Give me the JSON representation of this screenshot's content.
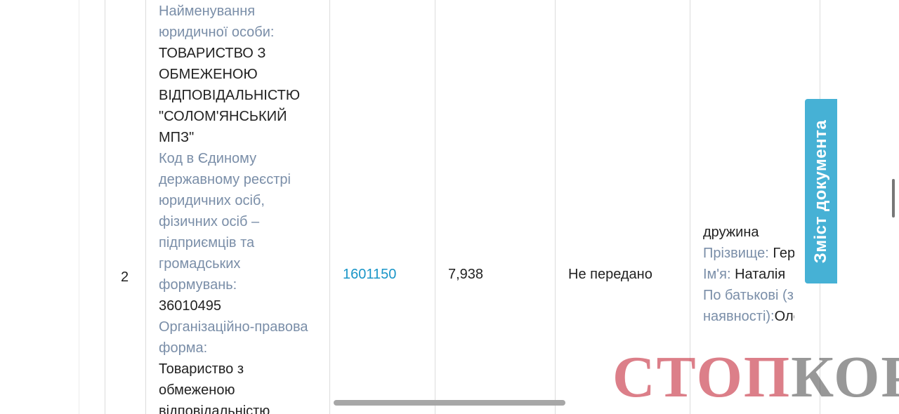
{
  "table": {
    "row_number": "2",
    "entity": {
      "name_label": "Найменування юридичної особи:",
      "name_value": "ТОВАРИСТВО З ОБМЕЖЕНОЮ ВІДПОВІДАЛЬНІСТЮ \"СОЛОМ'ЯНСЬКИЙ МПЗ\"",
      "code_label": "Код в Єдиному державному реєстрі юридичних осіб, фізичних осіб – підприємців та громадських формувань:",
      "code_value": "36010495",
      "form_label": "Організаційно-правова форма:",
      "form_value": "Товариство з обмеженою відповідальністю"
    },
    "object_code": "1601150",
    "share_percent": "7,938",
    "transfer_status": "Не передано",
    "relative": {
      "relation": "дружина",
      "surname_label": "Прізвище:",
      "surname_value": "Гер",
      "name_label": "Ім'я:",
      "name_value": "Наталія",
      "patronymic_label": "По батькові (з наявності):",
      "patronymic_value": "Оле"
    }
  },
  "side_tab": {
    "label": "Зміст документа",
    "color": "#46b1d5"
  },
  "watermark": {
    "part1": "СТОП",
    "part2": "КОР"
  }
}
